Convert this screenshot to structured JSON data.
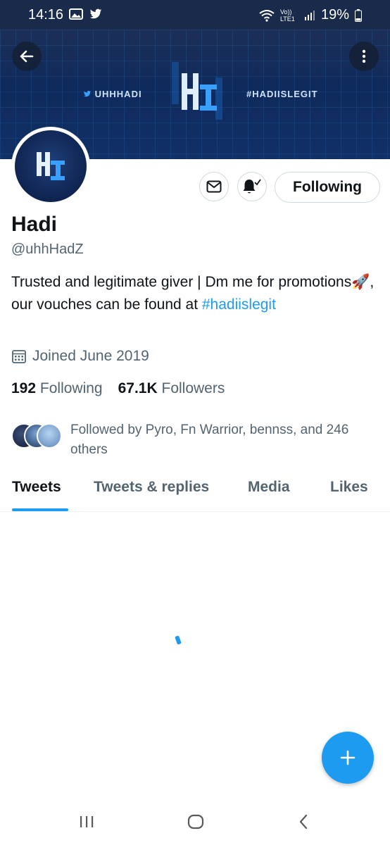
{
  "status_bar": {
    "time": "14:16",
    "network": "Vo)) LTE1",
    "battery": "19%"
  },
  "banner": {
    "left_text": "UHHHADI",
    "right_text": "#HADIISLEGIT",
    "colors": {
      "bg": "#0f2a5c",
      "accent": "#3aa0ff"
    }
  },
  "header": {
    "back_icon": "arrow-left-icon",
    "more_icon": "more-vertical-icon"
  },
  "profile": {
    "name": "Hadi",
    "handle": "@uhhHadZ",
    "bio_text": "Trusted and legitimate giver | Dm me for promotions🚀, our vouches can be found at ",
    "bio_hashtag": "#hadiislegit",
    "joined": "Joined June 2019",
    "following_count": "192",
    "following_label": "Following",
    "followers_count": "67.1K",
    "followers_label": "Followers",
    "followed_by": "Followed by Pyro, Fn Warrior, bennss, and 246 others"
  },
  "actions": {
    "message_icon": "mail-icon",
    "notify_icon": "bell-check-icon",
    "follow_button": "Following"
  },
  "tabs": [
    {
      "label": "Tweets",
      "active": true
    },
    {
      "label": "Tweets & replies",
      "active": false
    },
    {
      "label": "Media",
      "active": false
    },
    {
      "label": "Likes",
      "active": false
    }
  ],
  "fab": {
    "icon": "plus-icon"
  },
  "nav": {
    "recent_icon": "recents-icon",
    "home_icon": "home-icon",
    "back_icon": "back-icon"
  },
  "colors": {
    "primary": "#1d9bf0",
    "text": "#0f1419",
    "secondary": "#536471"
  }
}
